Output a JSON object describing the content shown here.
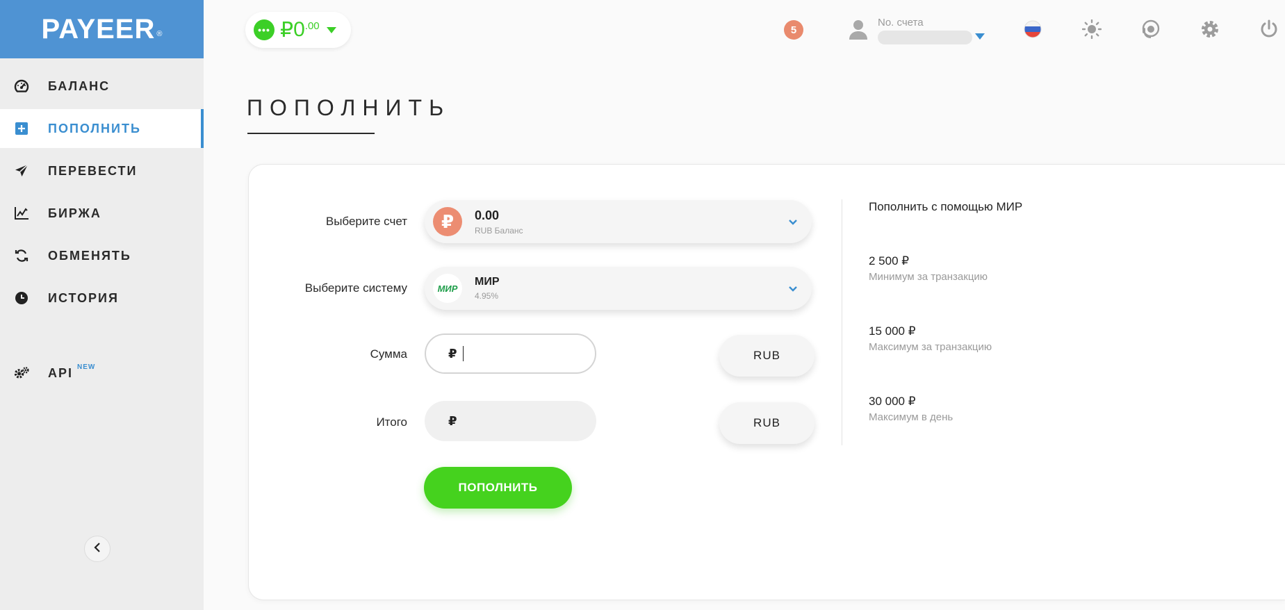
{
  "brand": {
    "name": "PAYEER",
    "reg": "®"
  },
  "sidebar": {
    "items": [
      {
        "label": "БАЛАНС",
        "icon": "dashboard-icon"
      },
      {
        "label": "ПОПОЛНИТЬ",
        "icon": "plus-square-icon",
        "active": true
      },
      {
        "label": "ПЕРЕВЕСТИ",
        "icon": "paper-plane-icon"
      },
      {
        "label": "БИРЖА",
        "icon": "line-chart-icon"
      },
      {
        "label": "ОБМЕНЯТЬ",
        "icon": "exchange-arrows-icon"
      },
      {
        "label": "ИСТОРИЯ",
        "icon": "clock-icon"
      },
      {
        "label": "API",
        "icon": "gears-icon",
        "badge": "NEW"
      }
    ],
    "collapse_icon": "chevron-left-icon"
  },
  "header": {
    "balance": {
      "currency_symbol": "₽",
      "integer": "0",
      "decimals": ".00",
      "dots": "•••"
    },
    "notifications_count": "5",
    "account": {
      "label": "No. счета"
    },
    "icons": [
      "russia-flag-icon",
      "sun-icon",
      "support-headset-icon",
      "gear-icon",
      "power-icon"
    ]
  },
  "page": {
    "title": "ПОПОЛНИТЬ"
  },
  "form": {
    "account_label": "Выберите счет",
    "account_value": "0.00",
    "account_sub": "RUB Баланс",
    "account_icon_glyph": "₽",
    "system_label": "Выберите систему",
    "system_name": "МИР",
    "system_fee": "4.95%",
    "system_logo_text": "МИР",
    "amount_label": "Сумма",
    "amount_currency_symbol": "₽",
    "amount_value": "",
    "amount_currency": "RUB",
    "total_label": "Итого",
    "total_currency_symbol": "₽",
    "total_currency": "RUB",
    "submit_label": "ПОПОЛНИТЬ"
  },
  "info": {
    "title": "Пополнить с помощью МИР",
    "limits": [
      {
        "value": "2 500 ₽",
        "desc": "Минимум за транзакцию"
      },
      {
        "value": "15 000 ₽",
        "desc": "Максимум за транзакцию"
      },
      {
        "value": "30 000 ₽",
        "desc": "Максимум в день"
      }
    ]
  },
  "colors": {
    "brand_blue": "#4f93d3",
    "active_blue": "#3a8ed0",
    "green": "#45d21e",
    "notif": "#e98a6d",
    "rub_icon": "#ec8d72"
  }
}
